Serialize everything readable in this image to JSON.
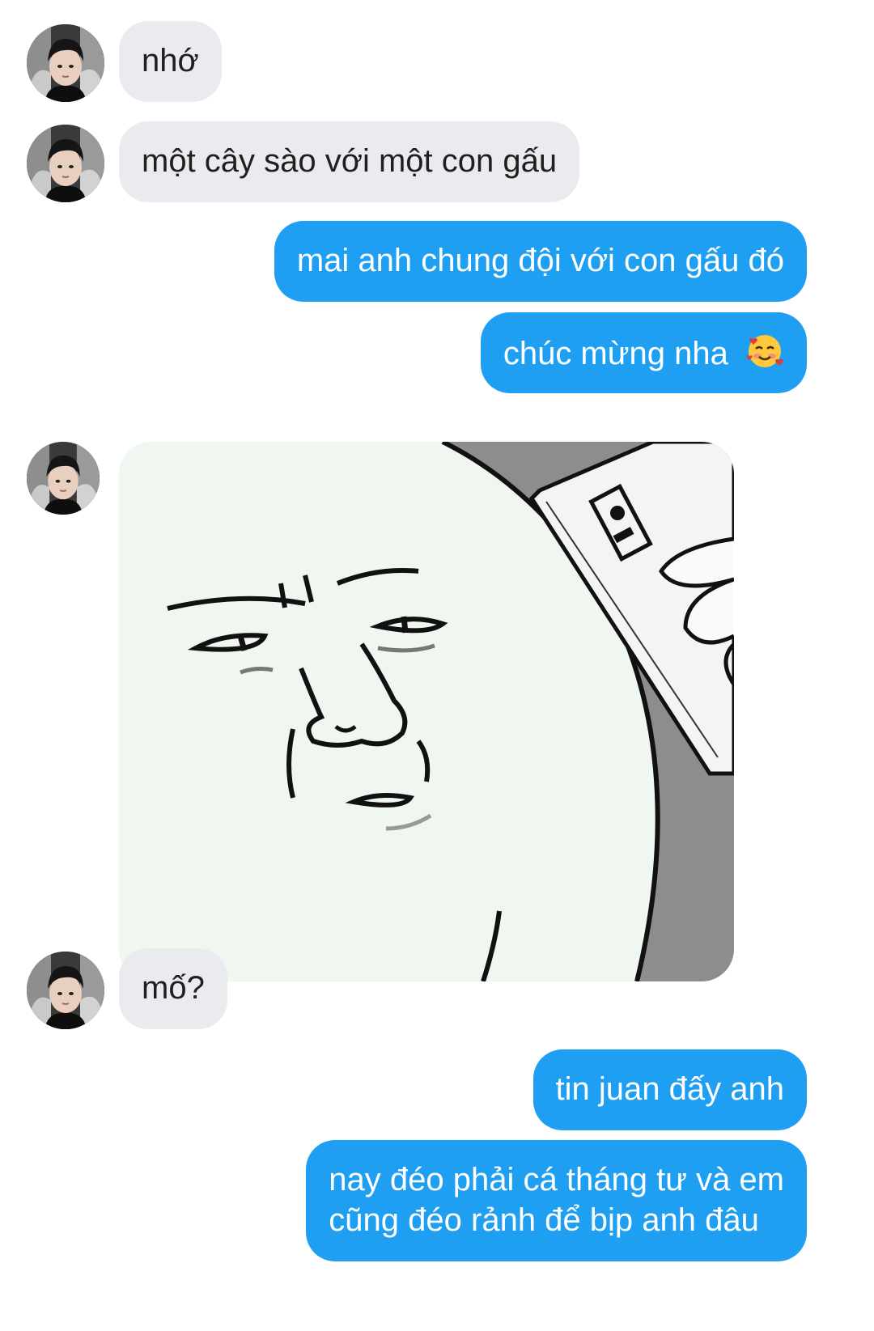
{
  "messages": [
    {
      "from": "them",
      "text": "nhớ"
    },
    {
      "from": "them",
      "text": "một cây sào với một con gấu"
    },
    {
      "from": "me",
      "text": "mai anh chung đội với con gấu đó"
    },
    {
      "from": "me",
      "text": "chúc mừng nha",
      "emoji": "smiling-face-with-hearts-emoji"
    },
    {
      "from": "them",
      "type": "sticker",
      "sticker": "meme-face-holding-phone-sticker"
    },
    {
      "from": "them",
      "text": "mố?"
    },
    {
      "from": "me",
      "text": "tin juan đấy anh"
    },
    {
      "from": "me",
      "lines": [
        "nay đéo phải cá tháng tư và em",
        "cũng đéo rảnh để bịp anh đâu"
      ]
    }
  ],
  "colors": {
    "incoming_bubble": "#e9ebee",
    "outgoing_bubble": "#1e9ff2",
    "incoming_text": "#1f1f1f",
    "outgoing_text": "#ffffff"
  },
  "icons": {
    "avatar": "profile-photo-avatar"
  }
}
